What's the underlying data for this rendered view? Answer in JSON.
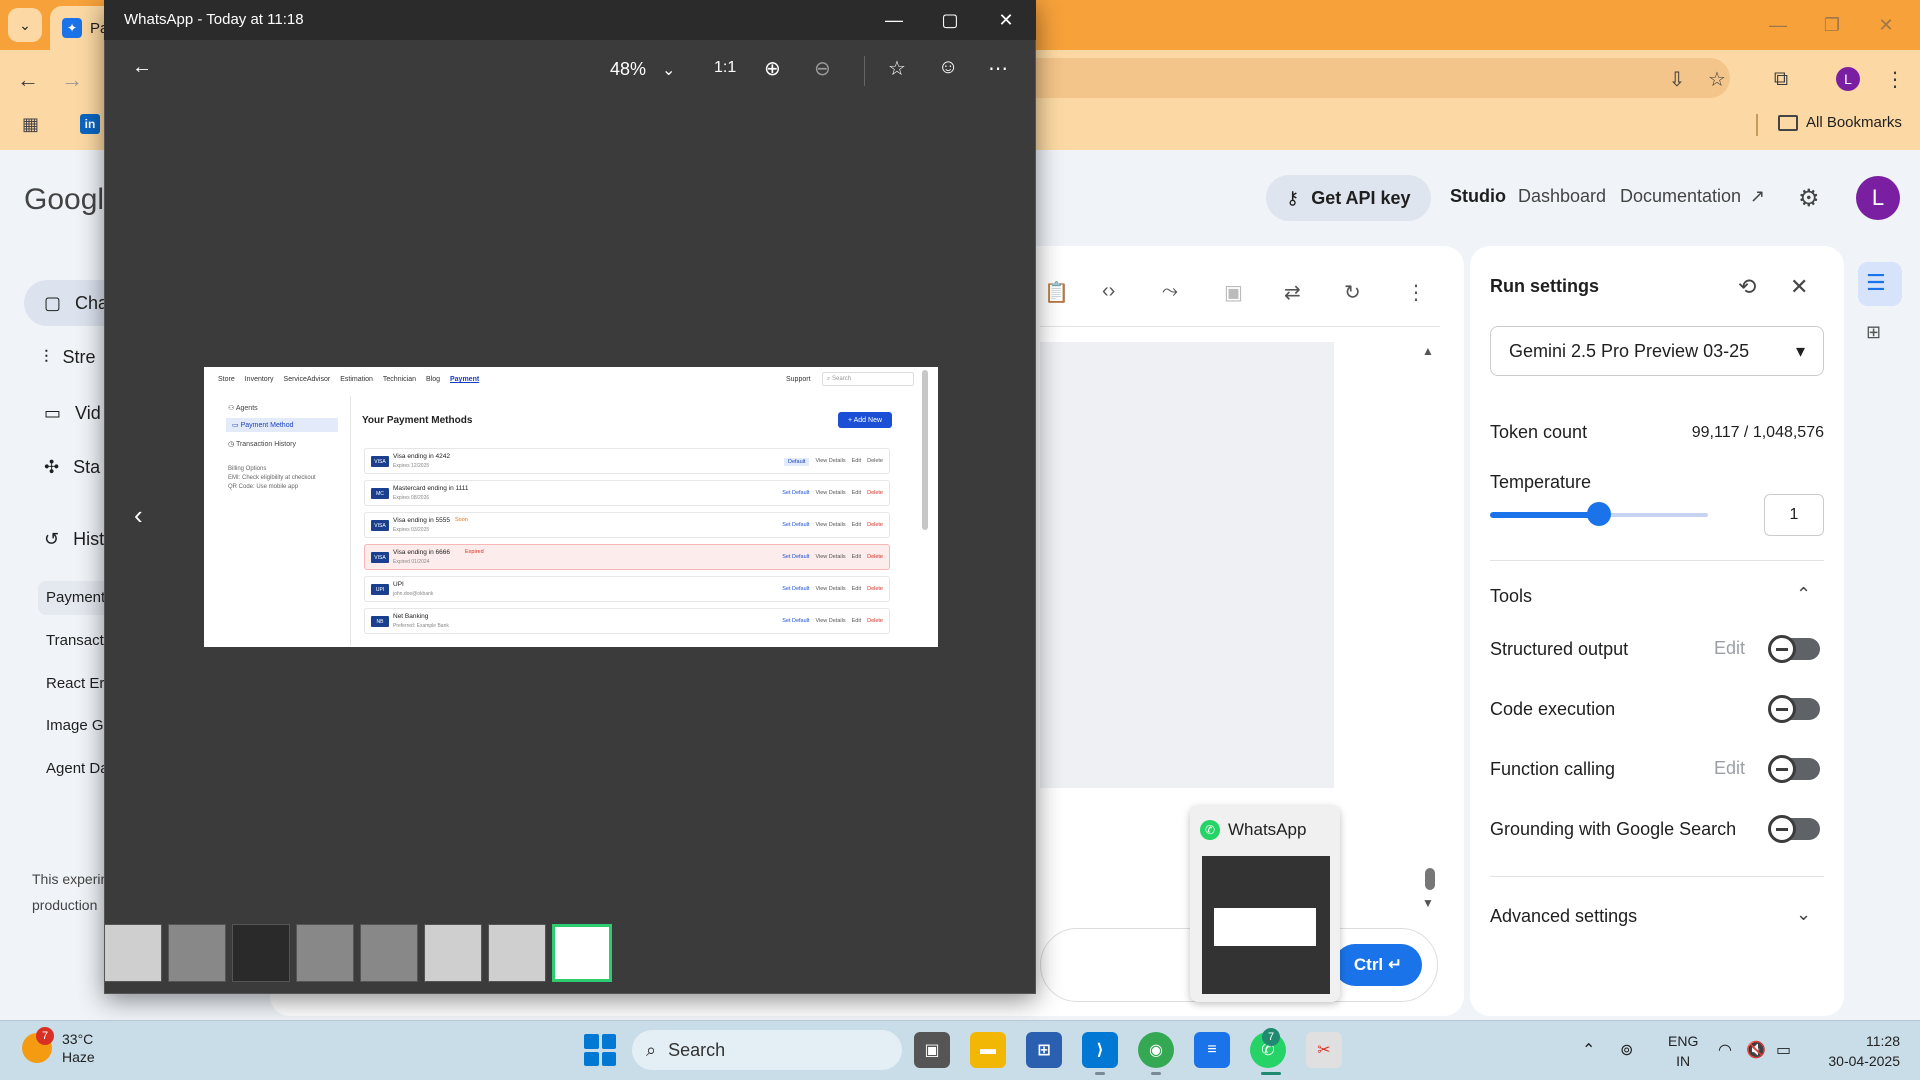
{
  "browser": {
    "tab_label": "Pa",
    "bookmark_li": "in",
    "all_bookmarks": "All Bookmarks",
    "profile_initial": "L"
  },
  "studio": {
    "logo_text": "Googl",
    "get_api_key": "Get API key",
    "nav": [
      "Studio",
      "Dashboard",
      "Documentation"
    ],
    "avatar_initial": "L",
    "sidebar": [
      {
        "label": "Cha",
        "icon": "chat-icon"
      },
      {
        "label": "Stre",
        "icon": "stream-icon"
      },
      {
        "label": "Vid",
        "icon": "video-icon"
      },
      {
        "label": "Sta",
        "icon": "starter-apps-icon"
      },
      {
        "label": "Hist",
        "icon": "history-icon"
      }
    ],
    "history": [
      "Payment",
      "Transact",
      "React Er",
      "Image G",
      "Agent Da"
    ],
    "note": "This experim feedback a production",
    "run_button": "Ctrl ↵"
  },
  "run_settings": {
    "title": "Run settings",
    "model": "Gemini 2.5 Pro Preview 03-25",
    "token_count_label": "Token count",
    "token_count_value": "99,117 / 1,048,576",
    "temperature_label": "Temperature",
    "temperature_value": "1",
    "temperature_fraction": 0.5,
    "tools_label": "Tools",
    "tools": [
      {
        "label": "Structured output",
        "edit": "Edit",
        "enabled": false
      },
      {
        "label": "Code execution",
        "edit": "",
        "enabled": false
      },
      {
        "label": "Function calling",
        "edit": "Edit",
        "enabled": false
      },
      {
        "label": "Grounding with Google Search",
        "edit": "",
        "enabled": false
      }
    ],
    "advanced_settings": "Advanced settings"
  },
  "whatsapp_preview": {
    "title": "WhatsApp"
  },
  "photo_viewer": {
    "title": "WhatsApp - Today at 11:18",
    "zoom": "48%",
    "inner_nav": [
      "Store",
      "Inventory",
      "ServiceAdvisor",
      "Estimation",
      "Technician",
      "Blog",
      "Payment"
    ],
    "inner_support": "Support",
    "inner_search": "Search",
    "inner_sidebar": [
      "Agents",
      "Payment Method",
      "Transaction History"
    ],
    "inner_billing_title": "Billing Options",
    "inner_billing_lines": [
      "EMI: Check eligibility at checkout",
      "QR Code: Use mobile app"
    ],
    "inner_heading": "Your Payment Methods",
    "inner_add_new": "+ Add New",
    "inner_cards": [
      {
        "name": "Visa ending in 4242",
        "sub": "Expires 12/2025",
        "tag": "",
        "expired": false,
        "default": true,
        "logo": "VISA"
      },
      {
        "name": "Mastercard ending in 1111",
        "sub": "Expires 08/2026",
        "tag": "",
        "expired": false,
        "default": false,
        "logo": "MC"
      },
      {
        "name": "Visa ending in 5555",
        "sub": "Expires 03/2025",
        "tag": "Soon",
        "expired": false,
        "default": false,
        "logo": "VISA"
      },
      {
        "name": "Visa ending in 6666",
        "sub": "Expired 01/2024",
        "tag": "Expired",
        "expired": true,
        "default": false,
        "logo": "VISA"
      },
      {
        "name": "UPI",
        "sub": "john.doe@okbank",
        "tag": "",
        "expired": false,
        "default": false,
        "logo": "UPI"
      },
      {
        "name": "Net Banking",
        "sub": "Preferred: Example Bank",
        "tag": "",
        "expired": false,
        "default": false,
        "logo": "NB"
      }
    ],
    "inner_actions": {
      "default": "Default",
      "set_default": "Set Default",
      "view": "View Details",
      "edit": "Edit",
      "delete": "Delete"
    }
  },
  "taskbar": {
    "weather_badge": "7",
    "temperature": "33°C",
    "condition": "Haze",
    "search": "Search",
    "whatsapp_badge": "7",
    "lang_top": "ENG",
    "lang_bottom": "IN",
    "time": "11:28",
    "date": "30-04-2025"
  }
}
